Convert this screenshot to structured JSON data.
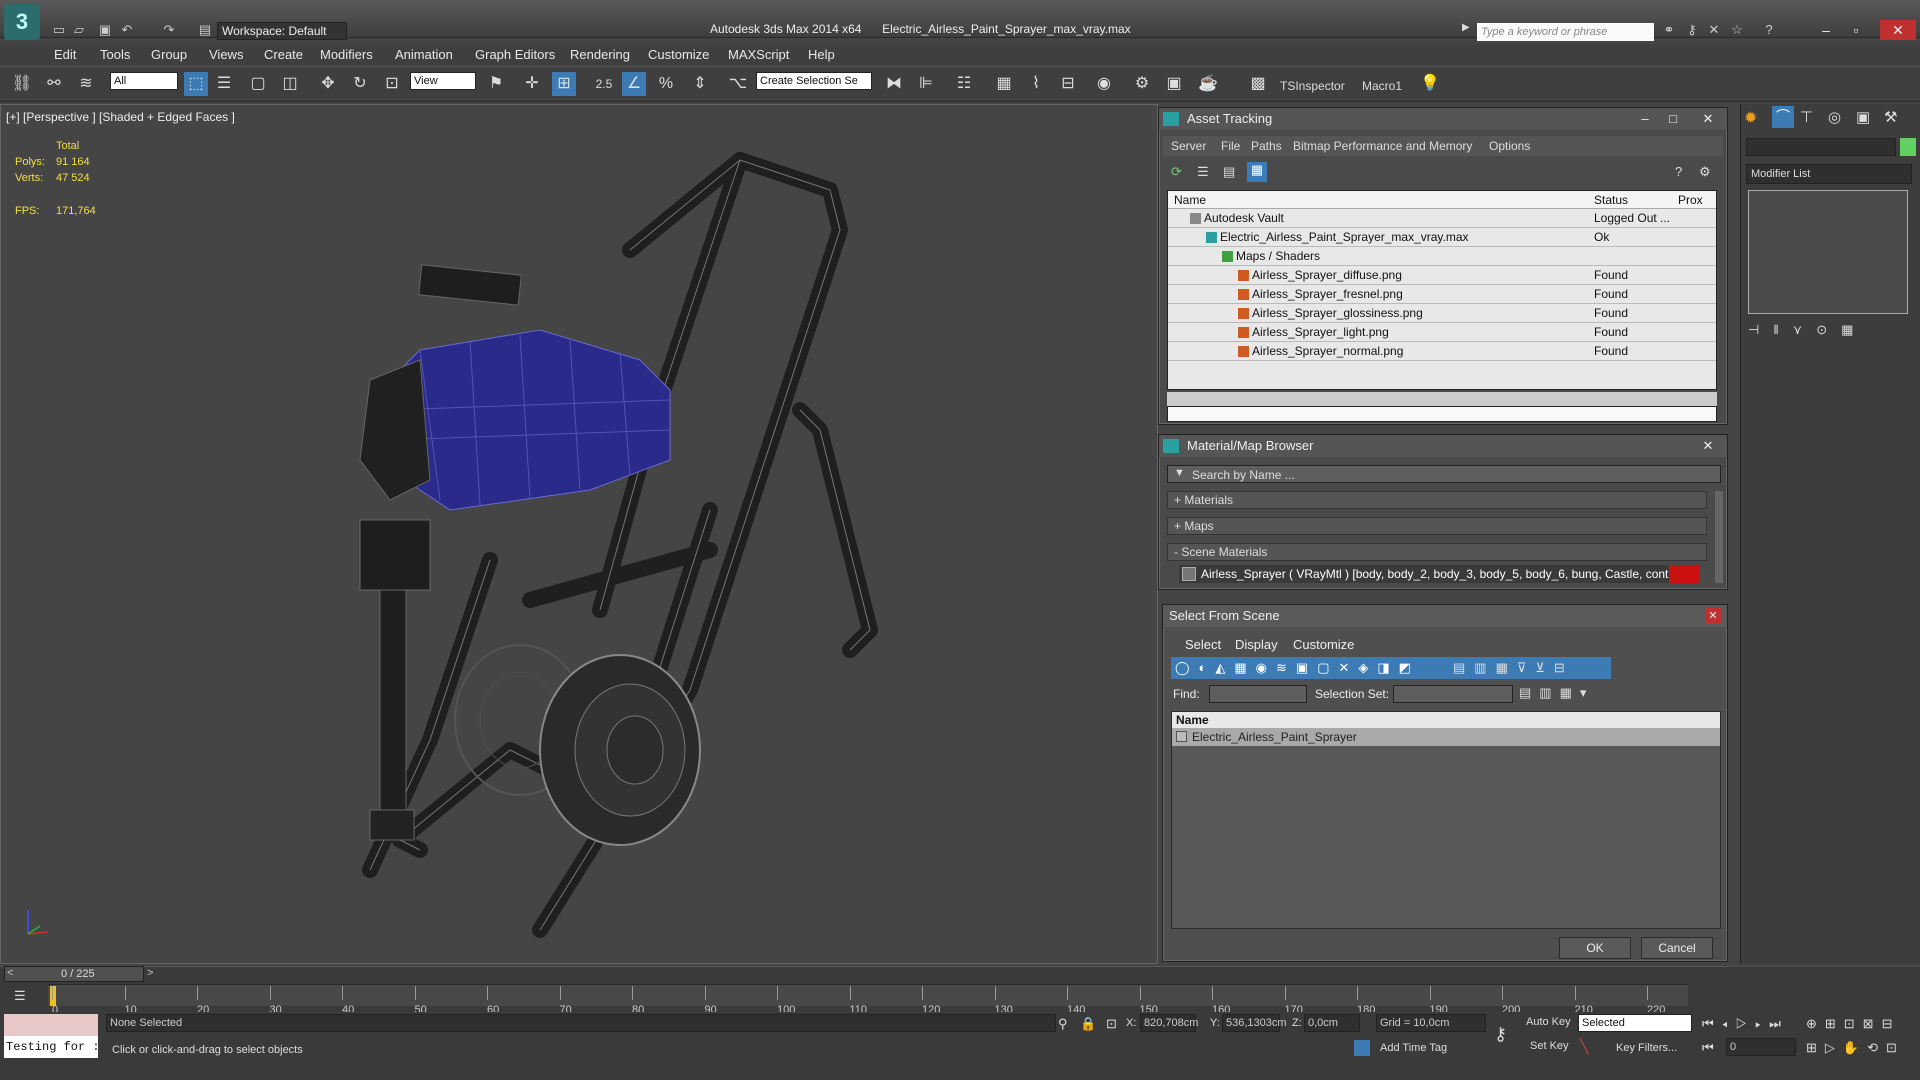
{
  "window": {
    "app_title": "Autodesk 3ds Max 2014 x64",
    "file_title": "Electric_Airless_Paint_Sprayer_max_vray.max",
    "workspace": "Workspace: Default",
    "search_placeholder": "Type a keyword or phrase"
  },
  "menu": [
    "Edit",
    "Tools",
    "Group",
    "Views",
    "Create",
    "Modifiers",
    "Animation",
    "Graph Editors",
    "Rendering",
    "Customize",
    "MAXScript",
    "Help"
  ],
  "toolbar": {
    "filter": "All",
    "ref_coord": "View",
    "selection_set": "Create Selection Se",
    "tsinspector": "TSInspector",
    "macro": "Macro1",
    "snap_angle": "2.5"
  },
  "viewport": {
    "label": "[+] [Perspective ] [Shaded + Edged Faces ]",
    "stats_header": "Total",
    "polys_label": "Polys:",
    "polys_value": "91 164",
    "verts_label": "Verts:",
    "verts_value": "47 524",
    "fps_label": "FPS:",
    "fps_value": "171,764"
  },
  "asset_tracking": {
    "title": "Asset Tracking",
    "menu": [
      "Server",
      "File",
      "Paths",
      "Bitmap Performance and Memory",
      "Options"
    ],
    "col_name": "Name",
    "col_status": "Status",
    "col_prox": "Prox",
    "rows": [
      {
        "name": "Autodesk Vault",
        "status": "Logged Out ...",
        "indent": 0
      },
      {
        "name": "Electric_Airless_Paint_Sprayer_max_vray.max",
        "status": "Ok",
        "indent": 1
      },
      {
        "name": "Maps / Shaders",
        "status": "",
        "indent": 2
      },
      {
        "name": "Airless_Sprayer_diffuse.png",
        "status": "Found",
        "indent": 3
      },
      {
        "name": "Airless_Sprayer_fresnel.png",
        "status": "Found",
        "indent": 3
      },
      {
        "name": "Airless_Sprayer_glossiness.png",
        "status": "Found",
        "indent": 3
      },
      {
        "name": "Airless_Sprayer_light.png",
        "status": "Found",
        "indent": 3
      },
      {
        "name": "Airless_Sprayer_normal.png",
        "status": "Found",
        "indent": 3
      }
    ]
  },
  "material_browser": {
    "title": "Material/Map Browser",
    "search_placeholder": "Search by Name ...",
    "sections": [
      "+ Materials",
      "+ Maps",
      "- Scene Materials"
    ],
    "scene_material": "Airless_Sprayer ( VRayMtl ) [body, body_2, body_3, body_5, body_6, bung, Castle, contr_pump..."
  },
  "select_from_scene": {
    "title": "Select From Scene",
    "menu": [
      "Select",
      "Display",
      "Customize"
    ],
    "find_label": "Find:",
    "selection_set_label": "Selection Set:",
    "col_name": "Name",
    "items": [
      "Electric_Airless_Paint_Sprayer"
    ],
    "ok": "OK",
    "cancel": "Cancel"
  },
  "command_panel": {
    "modifier_list": "Modifier List"
  },
  "timeline": {
    "frame_counter": "0 / 225",
    "ticks": [
      "0",
      "10",
      "20",
      "30",
      "40",
      "50",
      "60",
      "70",
      "80",
      "90",
      "100",
      "110",
      "120",
      "130",
      "140",
      "150",
      "160",
      "170",
      "180",
      "190",
      "200",
      "210",
      "220"
    ]
  },
  "status": {
    "selection": "None Selected",
    "prompt": "Click or click-and-drag to select objects",
    "script_listener": "Testing for :",
    "x_label": "X:",
    "x_value": "820,708cm",
    "y_label": "Y:",
    "y_value": "536,1303cm",
    "z_label": "Z:",
    "z_value": "0,0cm",
    "grid": "Grid = 10,0cm",
    "add_time_tag": "Add Time Tag",
    "auto_key": "Auto Key",
    "set_key": "Set Key",
    "selected": "Selected",
    "key_filters": "Key Filters...",
    "frame": "0"
  }
}
